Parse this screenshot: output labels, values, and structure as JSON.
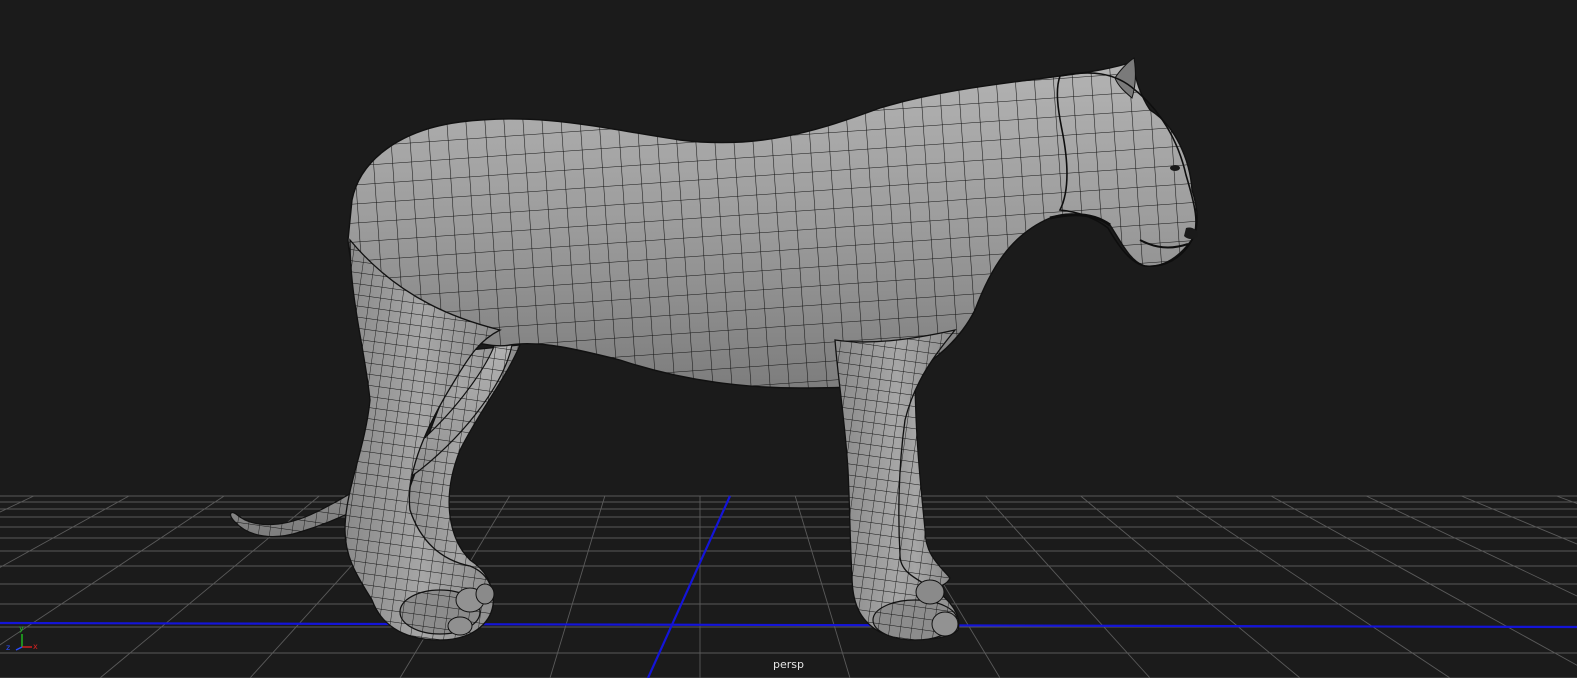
{
  "viewport": {
    "camera_label": "persp",
    "background_color": "#1b1b1b",
    "grid_color": "#5a5a5a",
    "origin_axis_color": "#1414d8",
    "mesh_color": "#9a9a9a",
    "wire_color": "#121212"
  },
  "axis_gizmo": {
    "y_label": "y",
    "x_label": "x",
    "z_label": "z",
    "x_color": "#d82020",
    "y_color": "#20c020",
    "z_color": "#2a4cff"
  }
}
